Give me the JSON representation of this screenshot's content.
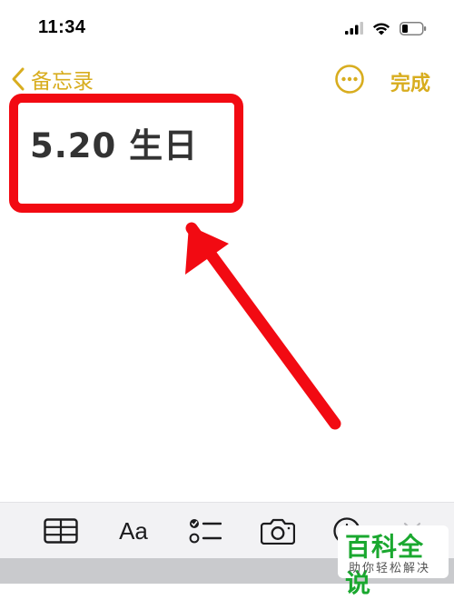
{
  "status_bar": {
    "time": "11:34"
  },
  "nav": {
    "back_label": "备忘录",
    "done_label": "完成"
  },
  "note": {
    "title": "5.20 生日"
  },
  "toolbar": {
    "format_label": "Aa",
    "icons": [
      "table-icon",
      "format-text-icon",
      "checklist-icon",
      "camera-icon",
      "markup-icon",
      "close-icon"
    ]
  },
  "watermark": {
    "title": "百科全说",
    "subtitle": "助你轻松解决"
  },
  "colors": {
    "accent": "#d8ad1f",
    "highlight": "#f20a12",
    "watermark": "#1aa82f",
    "toolbar_bg": "#f2f2f4"
  }
}
